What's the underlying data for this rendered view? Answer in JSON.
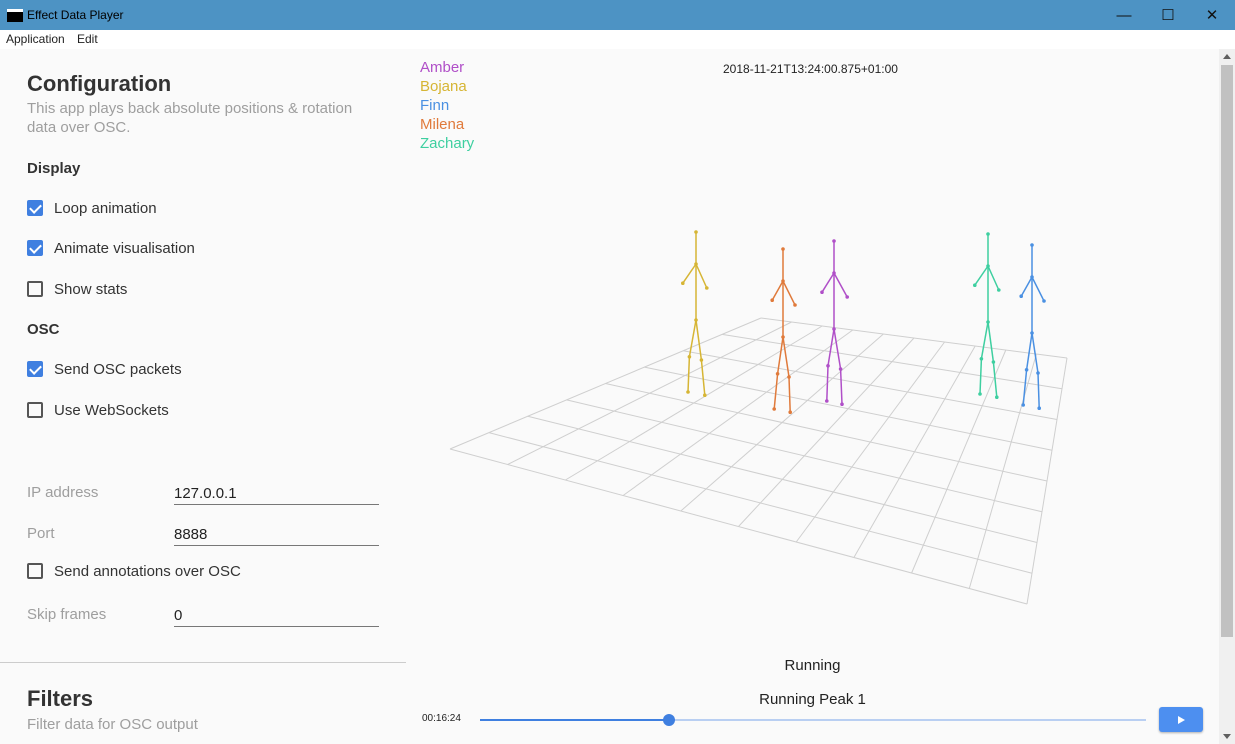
{
  "window": {
    "title": "Effect Data Player",
    "minimize_glyph": "—",
    "maximize_glyph": "☐",
    "close_glyph": "✕"
  },
  "menu": [
    "Application",
    "Edit"
  ],
  "config": {
    "title": "Configuration",
    "subtitle": "This app plays back absolute positions & rotation data over OSC.",
    "display_heading": "Display",
    "loop_label": "Loop animation",
    "loop_checked": true,
    "animate_label": "Animate visualisation",
    "animate_checked": true,
    "stats_label": "Show stats",
    "stats_checked": false,
    "osc_heading": "OSC",
    "send_osc_label": "Send OSC packets",
    "send_osc_checked": true,
    "websockets_label": "Use WebSockets",
    "websockets_checked": false,
    "ip_label": "IP address",
    "ip_value": "127.0.0.1",
    "port_label": "Port",
    "port_value": "8888",
    "annotations_label": "Send annotations over OSC",
    "annotations_checked": false,
    "skip_label": "Skip frames",
    "skip_value": "0"
  },
  "filters": {
    "title": "Filters",
    "subtitle": "Filter data for OSC output"
  },
  "legend": [
    {
      "name": "Amber",
      "color": "#b04fc8"
    },
    {
      "name": "Bojana",
      "color": "#d6b534"
    },
    {
      "name": "Finn",
      "color": "#4a90e2"
    },
    {
      "name": "Milena",
      "color": "#e07a3b"
    },
    {
      "name": "Zachary",
      "color": "#3ecfa0"
    }
  ],
  "timestamp": "2018-11-21T13:24:00.875+01:00",
  "status": "Running",
  "annotation": "Running Peak 1",
  "time": "00:16:24",
  "progress": 0.284,
  "accent": "#3f7fe0"
}
